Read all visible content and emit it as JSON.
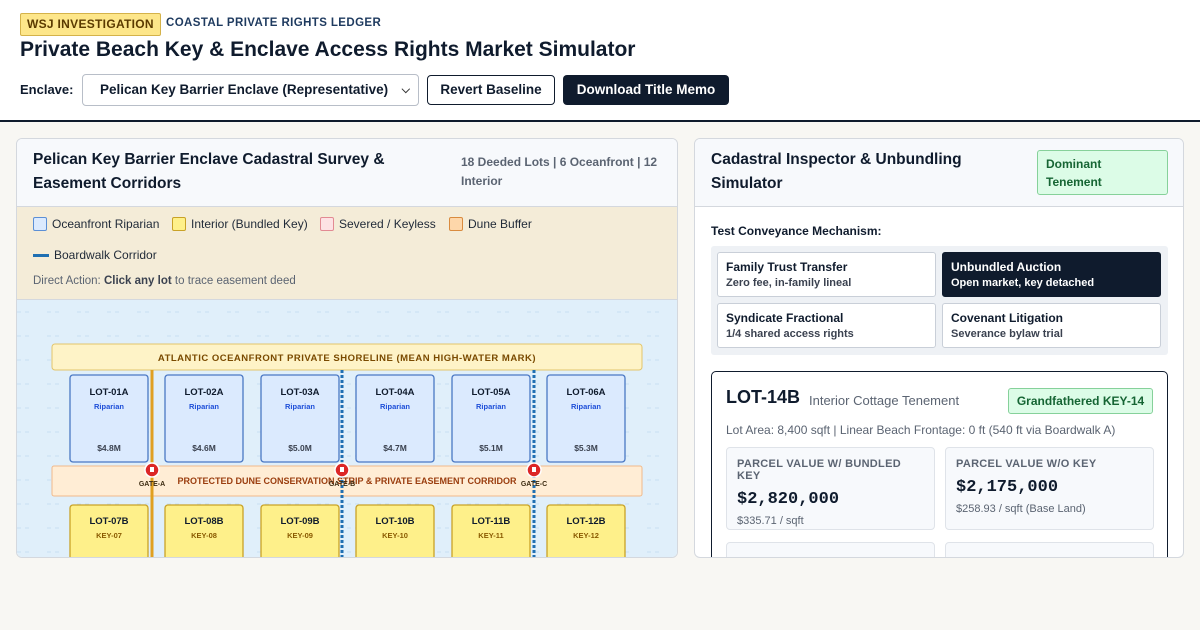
{
  "header": {
    "badge": "WSJ INVESTIGATION",
    "kicker": "COASTAL PRIVATE RIGHTS LEDGER",
    "title": "Private Beach Key & Enclave Access Rights Market Simulator",
    "enclave_label": "Enclave:",
    "enclave_value": "Pelican Key Barrier Enclave (Representative)",
    "revert_label": "Revert Baseline",
    "download_label": "Download Title Memo"
  },
  "map_panel": {
    "title": "Pelican Key Barrier Enclave Cadastral Survey & Easement Corridors",
    "stats": "18 Deeded Lots | 6 Oceanfront | 12 Interior",
    "legend": [
      {
        "label": "Oceanfront Riparian",
        "color": "#dbeafe",
        "border": "#5b8fd6"
      },
      {
        "label": "Interior (Bundled Key)",
        "color": "#fef08a",
        "border": "#c9a227"
      },
      {
        "label": "Severed / Keyless",
        "color": "#fde2e4",
        "border": "#e28a93"
      },
      {
        "label": "Dune Buffer",
        "color": "#fed7aa",
        "border": "#d98b3f"
      },
      {
        "label": "Boardwalk Corridor",
        "color": "#1f6fb2"
      }
    ],
    "direct_prefix": "Direct Action:",
    "direct_bold": "Click any lot",
    "direct_suffix": "to trace easement deed",
    "shoreline_label": "ATLANTIC OCEANFRONT PRIVATE SHORELINE (MEAN HIGH-WATER MARK)",
    "dune_label": "PROTECTED DUNE CONSERVATION STRIP & PRIVATE EASEMENT CORRIDOR",
    "gates": [
      "GATE-A",
      "GATE-B",
      "GATE-C"
    ],
    "oceanfront_lots": [
      {
        "id": "LOT-01A",
        "tag": "Riparian",
        "value": "$4.8M"
      },
      {
        "id": "LOT-02A",
        "tag": "Riparian",
        "value": "$4.6M"
      },
      {
        "id": "LOT-03A",
        "tag": "Riparian",
        "value": "$5.0M"
      },
      {
        "id": "LOT-04A",
        "tag": "Riparian",
        "value": "$4.7M"
      },
      {
        "id": "LOT-05A",
        "tag": "Riparian",
        "value": "$5.1M"
      },
      {
        "id": "LOT-06A",
        "tag": "Riparian",
        "value": "$5.3M"
      }
    ],
    "interior_lots": [
      {
        "id": "LOT-07B",
        "key": "KEY-07"
      },
      {
        "id": "LOT-08B",
        "key": "KEY-08"
      },
      {
        "id": "LOT-09B",
        "key": "KEY-09"
      },
      {
        "id": "LOT-10B",
        "key": "KEY-10"
      },
      {
        "id": "LOT-11B",
        "key": "KEY-11"
      },
      {
        "id": "LOT-12B",
        "key": "KEY-12"
      }
    ]
  },
  "inspector": {
    "title": "Cadastral Inspector & Unbundling Simulator",
    "badge": "Dominant Tenement",
    "test_label": "Test Conveyance Mechanism:",
    "mechanisms": [
      {
        "title": "Family Trust Transfer",
        "sub": "Zero fee, in-family lineal",
        "active": false
      },
      {
        "title": "Unbundled Auction",
        "sub": "Open market, key detached",
        "active": true
      },
      {
        "title": "Syndicate Fractional",
        "sub": "1/4 shared access rights",
        "active": false
      },
      {
        "title": "Covenant Litigation",
        "sub": "Severance bylaw trial",
        "active": false
      }
    ],
    "lot": {
      "id": "LOT-14B",
      "type": "Interior Cottage Tenement",
      "badge": "Grandfathered KEY-14",
      "area": "Lot Area: 8,400 sqft | Linear Beach Frontage: 0 ft (540 ft via Boardwalk A)",
      "with_key_label": "PARCEL VALUE W/ BUNDLED KEY",
      "with_key_value": "$2,820,000",
      "with_key_sub": "$335.71 / sqft",
      "without_key_label": "PARCEL VALUE W/O KEY",
      "without_key_value": "$2,175,000",
      "without_key_sub": "$258.93 / sqft (Base Land)"
    }
  }
}
